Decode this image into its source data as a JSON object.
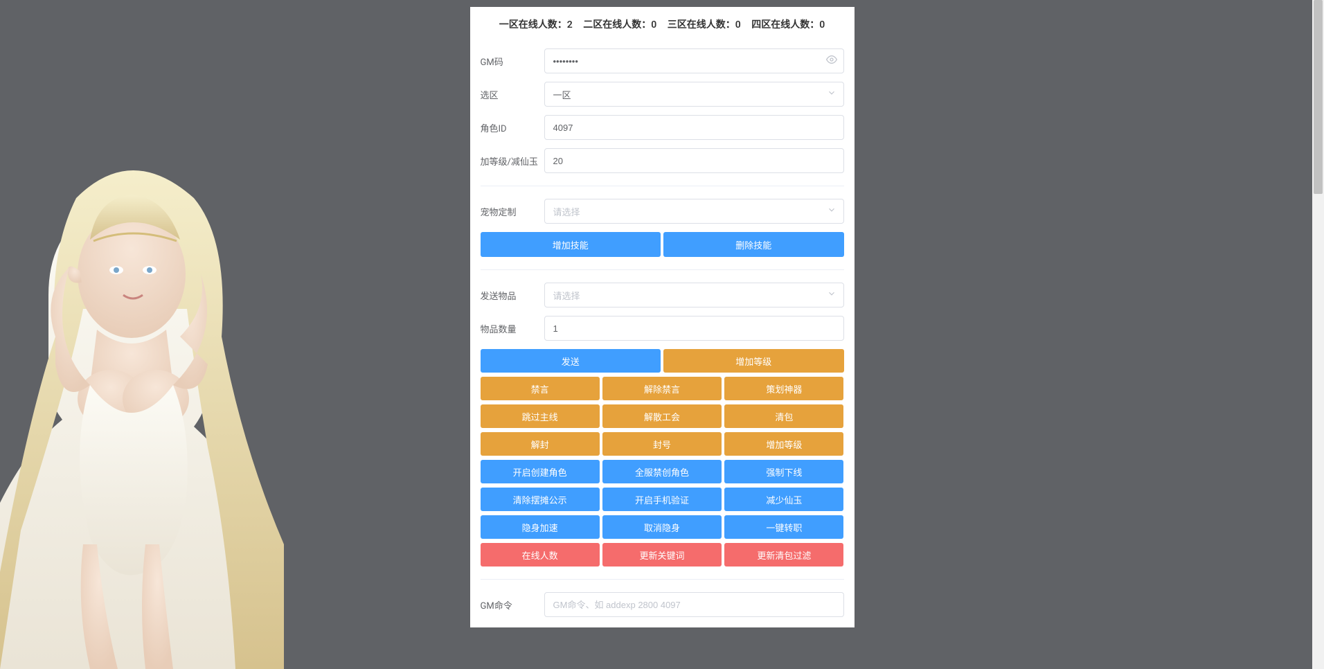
{
  "stats": {
    "zone1_label": "一区在线人数：",
    "zone1_count": "2",
    "zone2_label": "二区在线人数：",
    "zone2_count": "0",
    "zone3_label": "三区在线人数：",
    "zone3_count": "0",
    "zone4_label": "四区在线人数：",
    "zone4_count": "0"
  },
  "form": {
    "gm_code_label": "GM码",
    "gm_code_value": "••••••••",
    "zone_label": "选区",
    "zone_value": "一区",
    "role_id_label": "角色ID",
    "role_id_value": "4097",
    "level_label": "加等级/减仙玉",
    "level_value": "20",
    "pet_label": "宠物定制",
    "pet_placeholder": "请选择",
    "skill_add": "增加技能",
    "skill_del": "删除技能",
    "send_item_label": "发送物品",
    "send_item_placeholder": "请选择",
    "item_count_label": "物品数量",
    "item_count_value": "1",
    "gm_cmd_label": "GM命令",
    "gm_cmd_placeholder": "GM命令、如 addexp 2800 4097"
  },
  "buttons": {
    "row1": [
      "发送",
      "增加等级"
    ],
    "row2": [
      "禁言",
      "解除禁言",
      "策划神器"
    ],
    "row3": [
      "跳过主线",
      "解散工会",
      "清包"
    ],
    "row4": [
      "解封",
      "封号",
      "增加等级"
    ],
    "row5": [
      "开启创建角色",
      "全服禁创角色",
      "强制下线"
    ],
    "row6": [
      "清除摆摊公示",
      "开启手机验证",
      "减少仙玉"
    ],
    "row7": [
      "隐身加速",
      "取消隐身",
      "一键转职"
    ],
    "row8": [
      "在线人数",
      "更新关键词",
      "更新清包过滤"
    ]
  }
}
